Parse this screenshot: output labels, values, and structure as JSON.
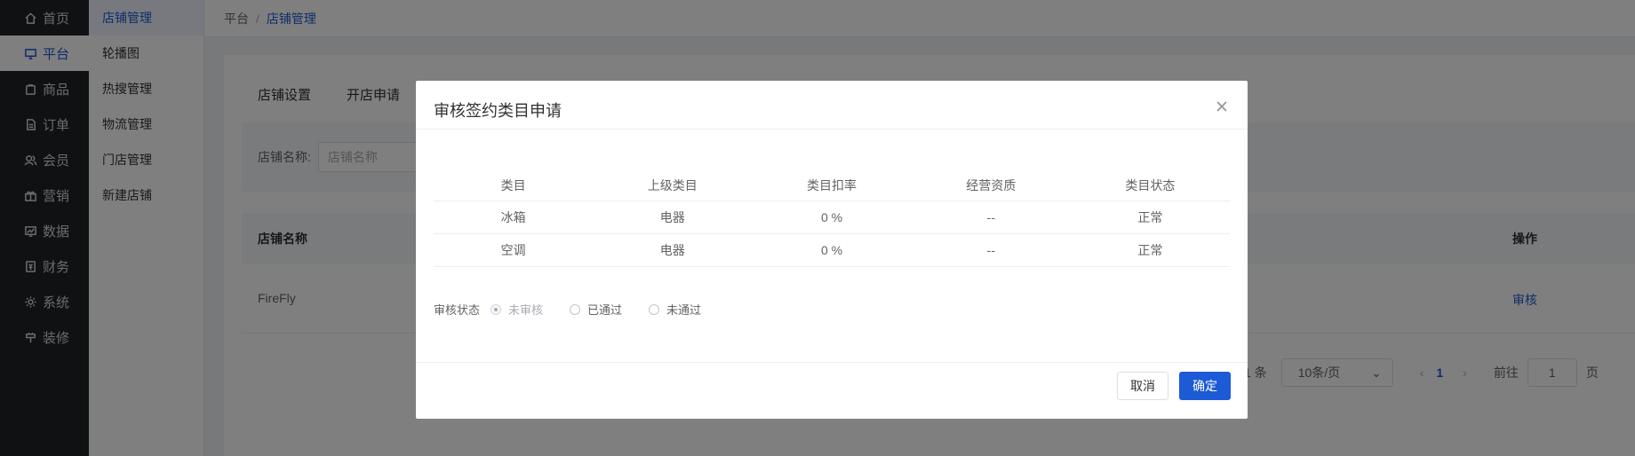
{
  "nav": [
    {
      "label": "首页",
      "icon": "home-icon"
    },
    {
      "label": "平台",
      "icon": "monitor-icon",
      "active": true
    },
    {
      "label": "商品",
      "icon": "bag-icon"
    },
    {
      "label": "订单",
      "icon": "document-icon"
    },
    {
      "label": "会员",
      "icon": "users-icon"
    },
    {
      "label": "营销",
      "icon": "gift-icon"
    },
    {
      "label": "数据",
      "icon": "chart-icon"
    },
    {
      "label": "财务",
      "icon": "finance-icon"
    },
    {
      "label": "系统",
      "icon": "gear-icon"
    },
    {
      "label": "装修",
      "icon": "brush-icon"
    }
  ],
  "subnav": [
    "店铺管理",
    "轮播图",
    "热搜管理",
    "物流管理",
    "门店管理",
    "新建店铺"
  ],
  "breadcrumb": {
    "root": "平台",
    "sep": "/",
    "current": "店铺管理"
  },
  "tabs": [
    "店铺设置",
    "开店申请"
  ],
  "search": {
    "label": "店铺名称:",
    "placeholder": "店铺名称"
  },
  "table": {
    "col_name": "店铺名称",
    "col_action": "操作",
    "rows": [
      {
        "name": "FireFly",
        "action": "审核"
      }
    ]
  },
  "pager": {
    "total_suffix": "1 条",
    "page_size": "10条/页",
    "prev": "‹",
    "page": "1",
    "next": "›",
    "goto": "前往",
    "goto_value": "1",
    "page_unit": "页"
  },
  "dialog": {
    "title": "审核签约类目申请",
    "columns": [
      "类目",
      "上级类目",
      "类目扣率",
      "经营资质",
      "类目状态"
    ],
    "rows": [
      [
        "冰箱",
        "电器",
        "0 %",
        "--",
        "正常"
      ],
      [
        "空调",
        "电器",
        "0 %",
        "--",
        "正常"
      ]
    ],
    "status_label": "审核状态",
    "status_options": [
      "未审核",
      "已通过",
      "未通过"
    ],
    "status_selected": "未审核",
    "cancel": "取消",
    "confirm": "确定"
  },
  "colors": {
    "primary": "#1c5ad6",
    "nav_bg": "#1f2227"
  }
}
